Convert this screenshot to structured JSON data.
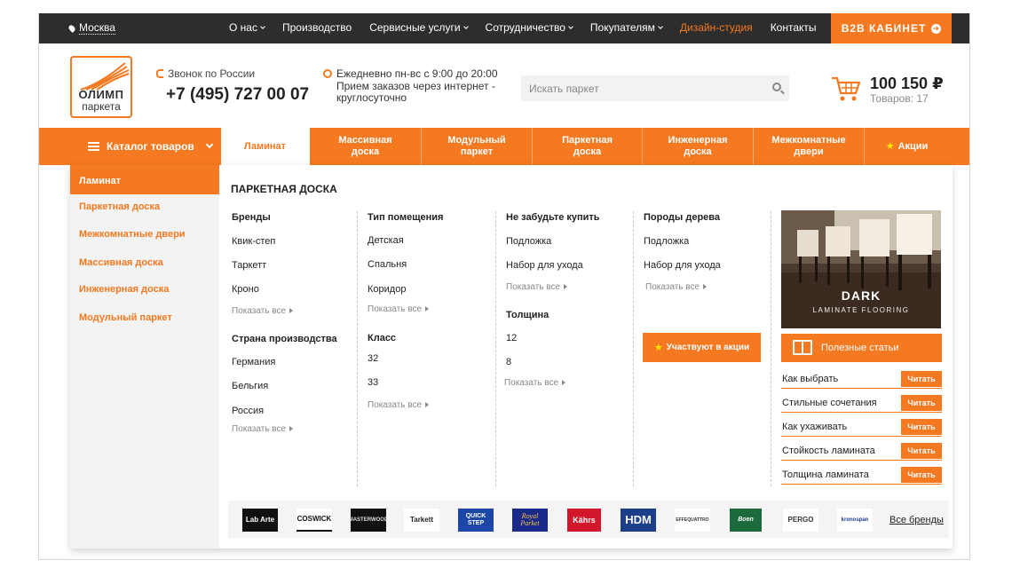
{
  "topbar": {
    "city": "Москва",
    "nav": [
      {
        "label": "О нас",
        "dropdown": true
      },
      {
        "label": "Производство",
        "dropdown": false
      },
      {
        "label": "Сервисные услуги",
        "dropdown": true
      },
      {
        "label": "Сотрудничество",
        "dropdown": true
      },
      {
        "label": "Покупателям",
        "dropdown": true
      },
      {
        "label": "Дизайн-студия",
        "dropdown": false,
        "accent": true
      },
      {
        "label": "Контакты",
        "dropdown": false
      }
    ],
    "b2b_label": "B2B КАБИНЕТ"
  },
  "header": {
    "logo_line1": "ОЛИМП",
    "logo_line2": "паркета",
    "phone_label": "Звонок по России",
    "phone": "+7 (495) 727 00 07",
    "hours": "Ежедневно пн-вс с 9:00 до 20:00",
    "orders": "Прием заказов через интернет - круглосуточно",
    "search_placeholder": "Искать паркет",
    "cart_sum": "100 150 ₽",
    "cart_count": "Товаров: 17"
  },
  "catnav": {
    "catalog_label": "Каталог товаров",
    "tabs": [
      "Ламинат",
      "Массивная доска",
      "Модульный паркет",
      "Паркетная доска",
      "Инженерная доска",
      "Межкомнатные двери",
      "Акции"
    ]
  },
  "sidebar": {
    "items": [
      "Ламинат",
      "Паркетная доска",
      "Межкомнатные двери",
      "Массивная доска",
      "Инженерная доска",
      "Модульный паркет"
    ]
  },
  "panel": {
    "title": "Паркетная доска",
    "more_label": "Показать все",
    "brands_heading": "Бренды",
    "brands": [
      "Квик-степ",
      "Таркетт",
      "Кроно"
    ],
    "country_heading": "Страна производства",
    "countries": [
      "Германия",
      "Бельгия",
      "Россия"
    ],
    "room_heading": "Тип помещения",
    "rooms": [
      "Детская",
      "Спальня",
      "Коридор"
    ],
    "class_heading": "Класс",
    "classes": [
      "32",
      "33"
    ],
    "dont_forget_heading": "Не забудьте купить",
    "dont_forget": [
      "Подложка",
      "Набор для ухода"
    ],
    "thickness_heading": "Толщина",
    "thickness": [
      "12",
      "8"
    ],
    "wood_heading": "Породы дерева",
    "wood": [
      "Подложка",
      "Набор для ухода"
    ],
    "promo_label": "Участвуют в акции",
    "banner_title": "DARK",
    "banner_subtitle": "LAMINATE FLOORING",
    "articles_button": "Полезные статьи",
    "read_label": "Читать",
    "articles": [
      "Как выбрать",
      "Стильные сочетания",
      "Как ухаживать",
      "Стойкость ламината",
      "Толщина ламината"
    ],
    "brand_logos": [
      "Lab Arte",
      "COSWICK",
      "MASTERWOOD",
      "Tarkett",
      "QUICK STEP",
      "Royal Parket",
      "Kährs",
      "HDM",
      "EFFEQUATTRO",
      "Boen",
      "PERGO",
      "kronospan"
    ],
    "all_brands": "Все бренды"
  },
  "colors": {
    "accent": "#f47920",
    "dark": "#2d2d2d",
    "star": "#ffe800"
  }
}
